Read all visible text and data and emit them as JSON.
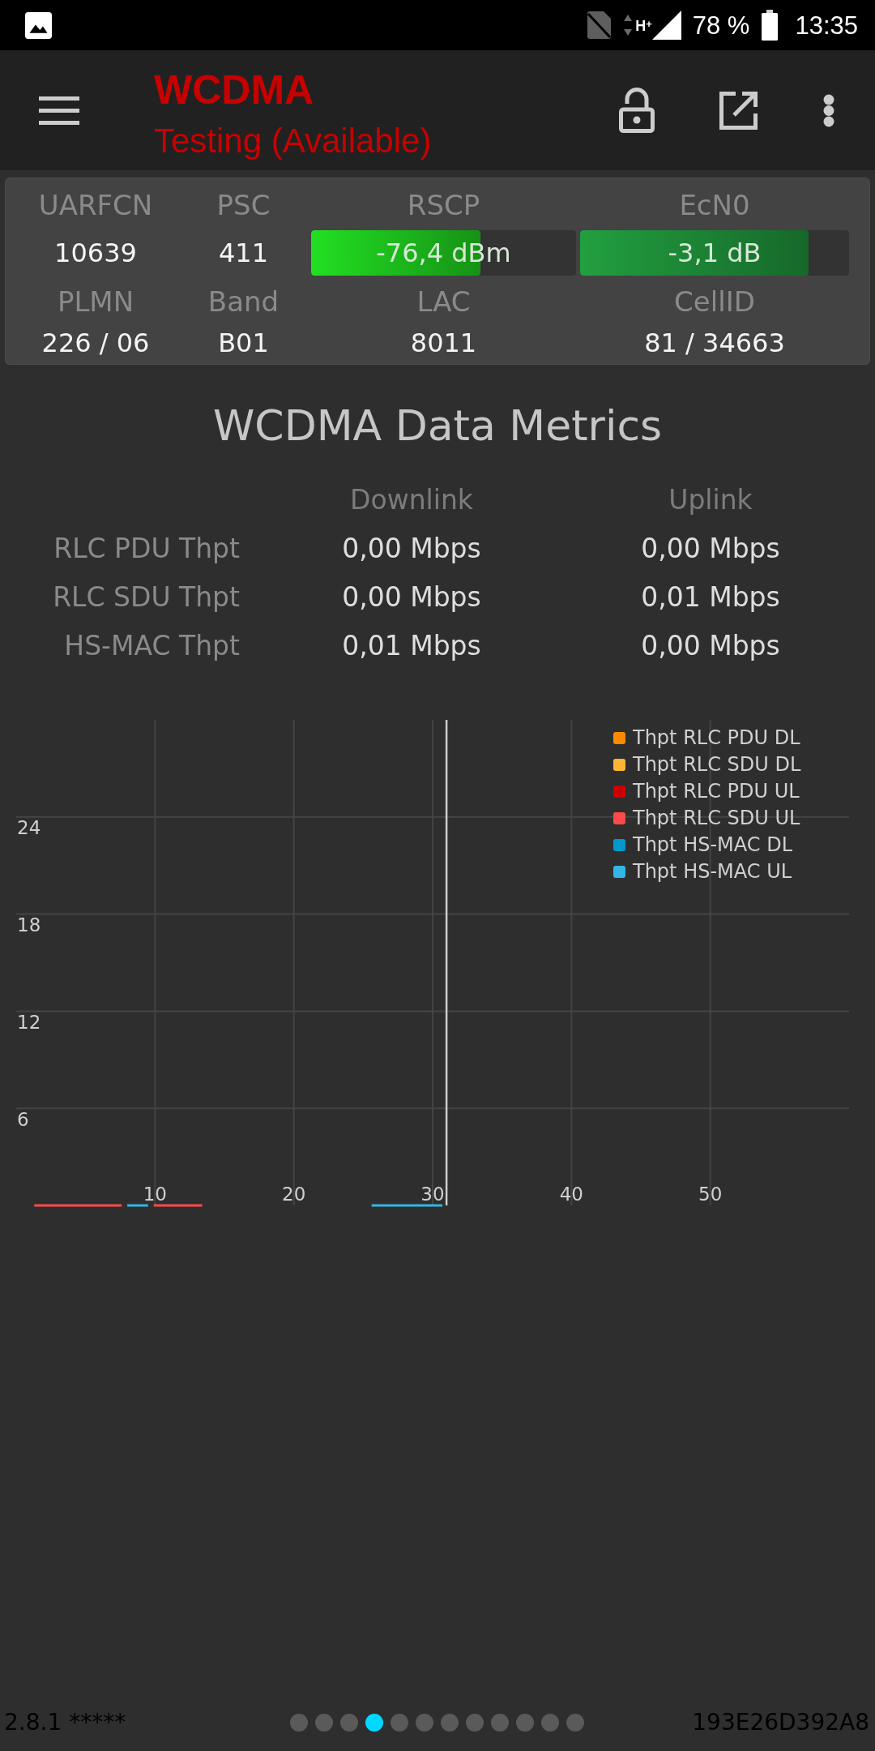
{
  "status_bar": {
    "network": "H$^{+}$",
    "battery": "78 %",
    "time": "13:35"
  },
  "toolbar": {
    "title": "WCDMA",
    "subtitle": "Testing (Available)"
  },
  "cell_info": {
    "rows": [
      {
        "fields": [
          {
            "kind": "text",
            "label": "UARFCN",
            "value": "10639"
          },
          {
            "kind": "text",
            "label": "PSC",
            "value": "411"
          },
          {
            "kind": "meter",
            "label": "RSCP",
            "value": "-76,4 dBm",
            "level": 0.64,
            "color": "#22e022"
          },
          {
            "kind": "meter",
            "label": "EcN0",
            "value": "-3,1 dB",
            "level": 0.85,
            "color": "#22a040"
          }
        ]
      },
      {
        "fields": [
          {
            "kind": "text",
            "label": "PLMN",
            "value": "226 / 06"
          },
          {
            "kind": "text",
            "label": "Band",
            "value": "B01"
          },
          {
            "kind": "text",
            "label": "LAC",
            "value": "8011"
          },
          {
            "kind": "text",
            "label": "CellID",
            "value": "81 / 34663"
          }
        ]
      }
    ]
  },
  "metrics": {
    "title": "WCDMA Data Metrics",
    "columns": [
      "Downlink",
      "Uplink"
    ],
    "rows": [
      {
        "label": "RLC PDU Thpt",
        "values": [
          "0,00 Mbps",
          "0,00 Mbps"
        ]
      },
      {
        "label": "RLC SDU Thpt",
        "values": [
          "0,00 Mbps",
          "0,01 Mbps"
        ]
      },
      {
        "label": "HS-MAC Thpt",
        "values": [
          "0,01 Mbps",
          "0,00 Mbps"
        ]
      }
    ]
  },
  "chart": {
    "chart_data": {
      "type": "line",
      "x": [
        1.3,
        7.6,
        8.0,
        9.5,
        9.9,
        13.4,
        25.6,
        30.7
      ],
      "xlim": [
        0,
        60
      ],
      "ylim": [
        0,
        30
      ],
      "xticks": [
        10,
        20,
        30,
        40,
        50
      ],
      "yticks": [
        6,
        12,
        18,
        24
      ],
      "grid": true,
      "legend": true,
      "series": [
        {
          "name": "Thpt RLC PDU DL",
          "color": "#ff8a00",
          "values": [
            null,
            null,
            null,
            null,
            null,
            null,
            null,
            null
          ]
        },
        {
          "name": "Thpt RLC SDU DL",
          "color": "#ffb733",
          "values": [
            null,
            null,
            null,
            null,
            null,
            null,
            null,
            null
          ]
        },
        {
          "name": "Thpt RLC PDU UL",
          "color": "#cc0000",
          "values": [
            null,
            null,
            null,
            null,
            null,
            null,
            null,
            null
          ]
        },
        {
          "name": "Thpt RLC SDU UL",
          "color": "#ff4a4a",
          "values": [
            0,
            0,
            null,
            null,
            0,
            0,
            null,
            null
          ]
        },
        {
          "name": "Thpt HS-MAC DL",
          "color": "#0099cc",
          "values": [
            null,
            null,
            null,
            null,
            null,
            null,
            null,
            null
          ]
        },
        {
          "name": "Thpt HS-MAC UL",
          "color": "#33b5e5",
          "values": [
            null,
            null,
            0,
            0,
            null,
            null,
            0,
            0
          ]
        }
      ],
      "ref_lines": [
        {
          "axis": "x",
          "value": 31
        }
      ]
    }
  },
  "page_indicator": [
    {
      "selected": false
    },
    {
      "selected": false
    },
    {
      "selected": false
    },
    {
      "selected": true
    },
    {
      "selected": false
    },
    {
      "selected": false
    },
    {
      "selected": false
    },
    {
      "selected": false
    },
    {
      "selected": false
    },
    {
      "selected": false
    },
    {
      "selected": false
    },
    {
      "selected": false
    }
  ],
  "footer": {
    "version": "2.8.1 *****",
    "device_id": "193E26D392A8"
  }
}
